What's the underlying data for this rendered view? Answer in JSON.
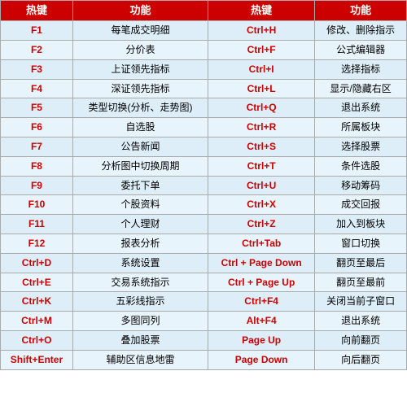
{
  "table": {
    "headers": [
      "热键",
      "功能",
      "热键",
      "功能"
    ],
    "rows": [
      {
        "hk1": "F1",
        "fn1": "每笔成交明细",
        "hk2": "Ctrl+H",
        "fn2": "修改、删除指示"
      },
      {
        "hk1": "F2",
        "fn1": "分价表",
        "hk2": "Ctrl+F",
        "fn2": "公式编辑器"
      },
      {
        "hk1": "F3",
        "fn1": "上证领先指标",
        "hk2": "Ctrl+I",
        "fn2": "选择指标"
      },
      {
        "hk1": "F4",
        "fn1": "深证领先指标",
        "hk2": "Ctrl+L",
        "fn2": "显示/隐藏右区"
      },
      {
        "hk1": "F5",
        "fn1": "类型切换(分析、走势图)",
        "hk2": "Ctrl+Q",
        "fn2": "退出系统"
      },
      {
        "hk1": "F6",
        "fn1": "自选股",
        "hk2": "Ctrl+R",
        "fn2": "所属板块"
      },
      {
        "hk1": "F7",
        "fn1": "公告新闻",
        "hk2": "Ctrl+S",
        "fn2": "选择股票"
      },
      {
        "hk1": "F8",
        "fn1": "分析图中切换周期",
        "hk2": "Ctrl+T",
        "fn2": "条件选股"
      },
      {
        "hk1": "F9",
        "fn1": "委托下单",
        "hk2": "Ctrl+U",
        "fn2": "移动筹码"
      },
      {
        "hk1": "F10",
        "fn1": "个股资料",
        "hk2": "Ctrl+X",
        "fn2": "成交回报"
      },
      {
        "hk1": "F11",
        "fn1": "个人理财",
        "hk2": "Ctrl+Z",
        "fn2": "加入到板块"
      },
      {
        "hk1": "F12",
        "fn1": "报表分析",
        "hk2": "Ctrl+Tab",
        "fn2": "窗口切换"
      },
      {
        "hk1": "Ctrl+D",
        "fn1": "系统设置",
        "hk2": "Ctrl + Page Down",
        "fn2": "翻页至最后"
      },
      {
        "hk1": "Ctrl+E",
        "fn1": "交易系统指示",
        "hk2": "Ctrl + Page Up",
        "fn2": "翻页至最前"
      },
      {
        "hk1": "Ctrl+K",
        "fn1": "五彩线指示",
        "hk2": "Ctrl+F4",
        "fn2": "关闭当前子窗口"
      },
      {
        "hk1": "Ctrl+M",
        "fn1": "多图同列",
        "hk2": "Alt+F4",
        "fn2": "退出系统"
      },
      {
        "hk1": "Ctrl+O",
        "fn1": "叠加股票",
        "hk2": "Page Up",
        "fn2": "向前翻页"
      },
      {
        "hk1": "Shift+Enter",
        "fn1": "辅助区信息地雷",
        "hk2": "Page Down",
        "fn2": "向后翻页"
      }
    ]
  }
}
